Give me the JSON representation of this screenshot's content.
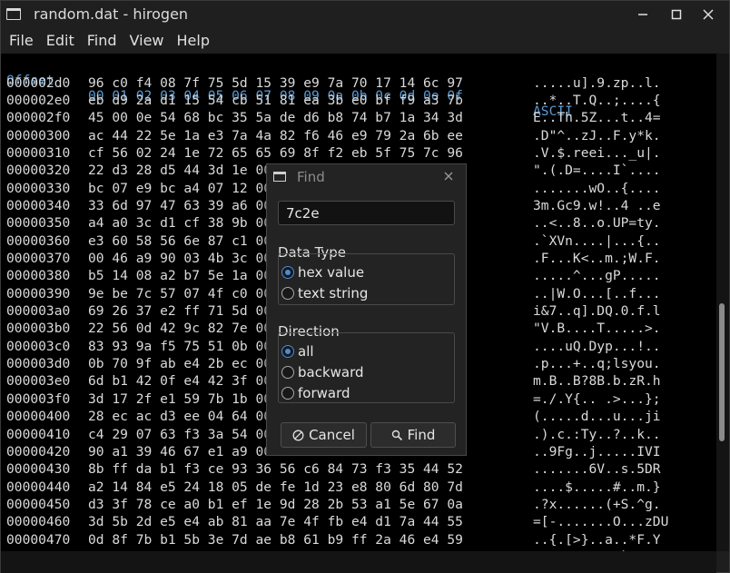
{
  "window": {
    "title": "random.dat - hirogen"
  },
  "menu": [
    "File",
    "Edit",
    "Find",
    "View",
    "Help"
  ],
  "hex": {
    "header": {
      "offset": "Offset",
      "bytes": "00 01 02 03 04 05 06 07 08 09 0a 0b 0c 0d 0e 0f",
      "ascii": "ASCII"
    },
    "rows": [
      {
        "offset": "000002d0",
        "bytes": "96 c0 f4 08 7f 75 5d 15 39 e9 7a 70 17 14 6c 97",
        "ascii": ".....u].9.zp..l."
      },
      {
        "offset": "000002e0",
        "bytes": "eb d9 2a d1 15 54 cb 51 81 ea 3b e0 bf f9 a3 7b",
        "ascii": "..*..T.Q..;....{"
      },
      {
        "offset": "000002f0",
        "bytes": "45 00 0e 54 68 bc 35 5a de d6 b8 74 b7 1a 34 3d",
        "ascii": "E..Th.5Z...t..4="
      },
      {
        "offset": "00000300",
        "bytes": "ac 44 22 5e 1a e3 7a 4a 82 f6 46 e9 79 2a 6b ee",
        "ascii": ".D\"^..zJ..F.y*k."
      },
      {
        "offset": "00000310",
        "bytes": "cf 56 02 24 1e 72 65 65 69 8f f2 eb 5f 75 7c 96",
        "ascii": ".V.$.reei..._u|."
      },
      {
        "offset": "00000320",
        "bytes": "22 d3 28 d5 44 3d 1e 00 00 00 49 60 00 00 9a b1",
        "ascii": "\".(.D=....I`...."
      },
      {
        "offset": "00000330",
        "bytes": "bc 07 e9 bc a4 07 12 00 00 77 4f 07 7b 00 d2 05",
        "ascii": ".......wO..{...."
      },
      {
        "offset": "00000340",
        "bytes": "33 6d 97 47 63 39 a6 00 00 00 34 20 00 1a 65",
        "ascii": "3m.Gc9.w!..4 ..e"
      },
      {
        "offset": "00000350",
        "bytes": "a4 a0 3c d1 cf 38 9b 00 00 00 55 50 3d 00 79 80",
        "ascii": "..<..8..o.UP=ty."
      },
      {
        "offset": "00000360",
        "bytes": "e3 60 58 56 6e 87 c1 00 00 00 7c 00 00 00 9a ac",
        "ascii": ".`XVn....|...{.."
      },
      {
        "offset": "00000370",
        "bytes": "00 46 a9 90 03 4b 3c 00 00 00 57 00 46 00 46 d0",
        "ascii": ".F...K<..m.;W.F."
      },
      {
        "offset": "00000380",
        "bytes": "b5 14 08 a2 b7 5e 1a 00 00 00 67 50 00 00 b4 e9",
        "ascii": ".....^...gP....."
      },
      {
        "offset": "00000390",
        "bytes": "9e be 7c 57 07 4f c0 00 00 00 5b 00 66 00 f2 12",
        "ascii": "..|W.O...[..f..."
      },
      {
        "offset": "000003a0",
        "bytes": "69 26 37 e2 ff 71 5d 00 00 00 51 00 30 00 a6 6c",
        "ascii": "i&7..q].DQ.0.f.l"
      },
      {
        "offset": "000003b0",
        "bytes": "22 56 0d 42 9c 82 7e 00 00 00 54 00 00 00 3e 14",
        "ascii": "\"V.B....T.....>."
      },
      {
        "offset": "000003c0",
        "bytes": "83 93 9a f5 75 51 0b 00 00 00 44 79 70 00 d1 18",
        "ascii": "....uQ.Dyp...!.."
      },
      {
        "offset": "000003d0",
        "bytes": "0b 70 9f ab e4 2b ec 00 00 00 71 3b 6c 00 75 c7",
        "ascii": ".p...+..q;lsyou."
      },
      {
        "offset": "000003e0",
        "bytes": "6d b1 42 0f e4 42 3f 00 00 00 38 42 2e 00 9a 68",
        "ascii": "m.B..B?8B.b.zR.h"
      },
      {
        "offset": "000003f0",
        "bytes": "3d 17 2f e1 59 7b 1b 00 00 00 20 00 3e 00 7d 3b",
        "ascii": "=./.Y{.. .>...};"
      },
      {
        "offset": "00000400",
        "bytes": "28 ec ac d3 ee 04 64 00 00 00 75 00 2e 00 6a 69",
        "ascii": "(.....d...u...ji"
      },
      {
        "offset": "00000410",
        "bytes": "c4 29 07 63 f3 3a 54 00 00 00 3f 00 2e 00 15 d6",
        "ascii": ".).c.:Ty..?..k.."
      },
      {
        "offset": "00000420",
        "bytes": "90 a1 39 46 67 e1 a9 00 00 00 00 00 00 00 56 49",
        "ascii": "..9Fg..j.....IVI"
      },
      {
        "offset": "00000430",
        "bytes": "8b ff da b1 f3 ce 93 36 56 c6 84 73 f3 35 44 52",
        "ascii": ".......6V..s.5DR"
      },
      {
        "offset": "00000440",
        "bytes": "a2 14 84 e5 24 18 05 de fe 1d 23 e8 80 6d 80 7d",
        "ascii": "....$.....#..m.}"
      },
      {
        "offset": "00000450",
        "bytes": "d3 3f 78 ce a0 b1 ef 1e 9d 28 2b 53 a1 5e 67 0a",
        "ascii": ".?x......(+S.^g."
      },
      {
        "offset": "00000460",
        "bytes": "3d 5b 2d e5 e4 ab 81 aa 7e 4f fb e4 d1 7a 44 55",
        "ascii": "=[-.......O...zDU"
      },
      {
        "offset": "00000470",
        "bytes": "0d 8f 7b b1 5b 3e 7d ae b8 61 b9 ff 2a 46 e4 59",
        "ascii": "..{.[>}..a..*F.Y"
      },
      {
        "offset": "00000480",
        "bytes": "b1 87 ed 6c 4d 3d 8e ff ee 8f e3 60 14 f6 c4 52",
        "ascii": "...lM=.....`...R"
      }
    ]
  },
  "find_dialog": {
    "title": "Find",
    "query": "7c2e",
    "data_type_label": "Data Type",
    "data_type_options": [
      {
        "label": "hex value",
        "selected": true
      },
      {
        "label": "text string",
        "selected": false
      }
    ],
    "direction_label": "Direction",
    "direction_options": [
      {
        "label": "all",
        "selected": true
      },
      {
        "label": "backward",
        "selected": false
      },
      {
        "label": "forward",
        "selected": false
      }
    ],
    "cancel_label": "Cancel",
    "find_label": "Find"
  },
  "colors": {
    "header_blue": "#5b9bd5",
    "radio_accent": "#4a8cd8"
  },
  "icons": [
    "app-window-icon",
    "minimize-icon",
    "maximize-icon",
    "close-icon",
    "cancel-circle-icon",
    "search-icon"
  ]
}
